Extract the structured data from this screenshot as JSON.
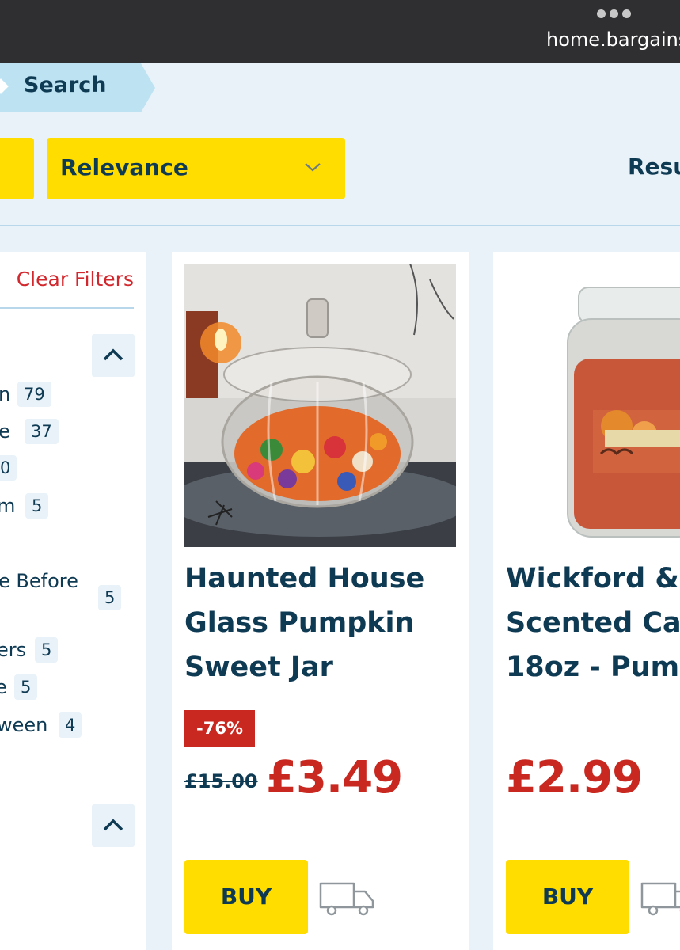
{
  "browser": {
    "url": "home.bargains",
    "menu_icon": "more-dots-icon"
  },
  "breadcrumb": {
    "label": "Search"
  },
  "toolbar": {
    "sort_value": "Relevance",
    "results_label": "Resu"
  },
  "filters": {
    "clear_label": "Clear Filters",
    "items": [
      {
        "label": "n",
        "count": "79"
      },
      {
        "label": "e",
        "count": "37"
      },
      {
        "label": "0",
        "count": ""
      },
      {
        "label": "m",
        "count": "5"
      },
      {
        "label": "e Before",
        "count": "5"
      },
      {
        "label": "ers",
        "count": "5"
      },
      {
        "label": "e",
        "count": "5"
      },
      {
        "label": "ween",
        "count": "4"
      }
    ]
  },
  "products": [
    {
      "title": "Haunted House Glass Pumpkin Sweet Jar",
      "discount": "-76%",
      "was_price": "£15.00",
      "price": "£3.49",
      "buy_label": "BUY"
    },
    {
      "title": "Wickford & Scented Car 18oz - Pump",
      "title_lines": [
        "Wickford &",
        "Scented Car",
        "18oz - Pump"
      ],
      "price": "£2.99",
      "buy_label": "BUY"
    }
  ],
  "colors": {
    "accent_yellow": "#ffdd00",
    "navy": "#0f3a53",
    "sale_red": "#c8281f",
    "background": "#e8f2f8"
  }
}
